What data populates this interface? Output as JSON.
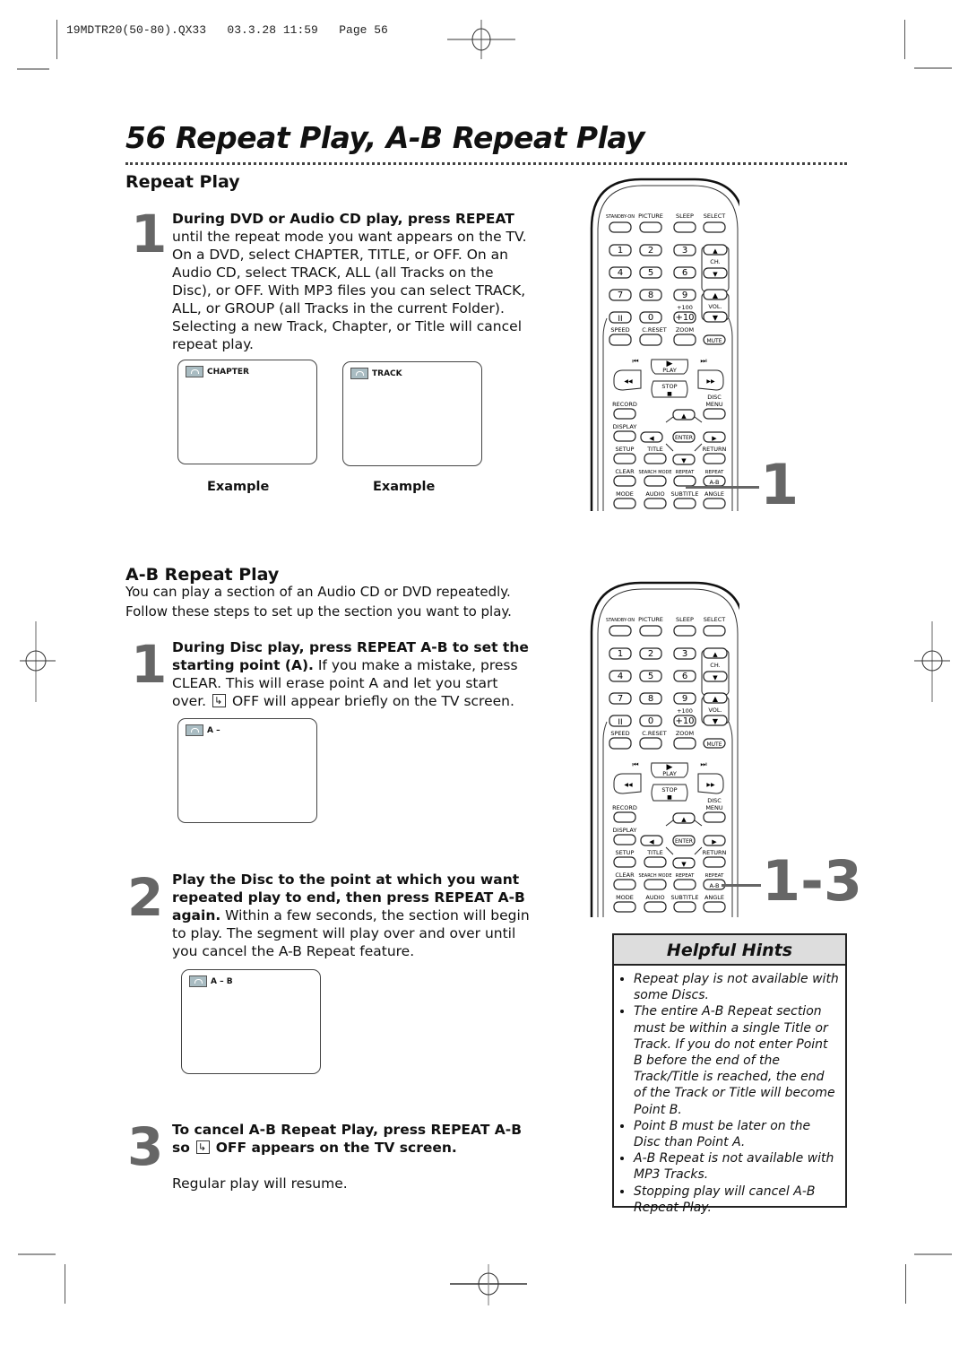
{
  "slug": "19MDTR20(50-80).QX33   03.3.28 11:59   Page 56",
  "page_title": "56  Repeat Play, A-B Repeat Play",
  "repeat_play": {
    "heading": "Repeat Play",
    "step1": {
      "number": "1",
      "bold": "During DVD or Audio CD play, press REPEAT",
      "text": "until the repeat mode you want appears on the TV. On a DVD, select CHAPTER, TITLE, or OFF.  On an Audio CD, select TRACK, ALL (all Tracks on the Disc), or OFF.  With MP3 files you can select TRACK, ALL, or GROUP (all Tracks in the current Folder).  Selecting a new Track, Chapter, or Title will cancel repeat play."
    },
    "screens": [
      {
        "label": "CHAPTER",
        "caption": "Example"
      },
      {
        "label": "TRACK",
        "caption": "Example"
      }
    ]
  },
  "ab_repeat": {
    "heading": "A-B Repeat Play",
    "intro": "You can play a section of an Audio CD or DVD repeatedly. Follow these steps to set up the section you want to play.",
    "step1": {
      "number": "1",
      "bold": "During Disc play, press REPEAT A-B to set the starting point (A).",
      "text1": " If you make a mistake, press CLEAR.  This will erase point A and let you start over.",
      "text2": "OFF will appear briefly on the TV screen.",
      "screen_label": "A –"
    },
    "step2": {
      "number": "2",
      "bold": "Play the Disc to the point at which you want repeated play to end, then press REPEAT A-B again.",
      "text": " Within a few seconds, the section will begin to play. The segment will play over and over until you cancel the A-B Repeat feature.",
      "screen_label": "A – B"
    },
    "step3": {
      "number": "3",
      "bold1": "To cancel A-B Repeat Play, press REPEAT A-B so",
      "bold2": "OFF appears on the TV screen.",
      "text": "Regular play will resume."
    }
  },
  "remote": {
    "top_labels": [
      "STANDBY-ON",
      "PICTURE",
      "SLEEP",
      "SELECT"
    ],
    "digits": [
      "1",
      "2",
      "3",
      "4",
      "5",
      "6",
      "7",
      "8",
      "9",
      "0",
      "+10"
    ],
    "plus100": "+100",
    "ch_label": "CH.",
    "vol_label": "VOL.",
    "speed": "SPEED",
    "creset": "C.RESET",
    "zoom": "ZOOM",
    "mute": "MUTE",
    "play": "PLAY",
    "stop": "STOP",
    "record": "RECORD",
    "disc_menu1": "DISC",
    "disc_menu2": "MENU",
    "display": "DISPLAY",
    "enter": "ENTER",
    "setup": "SETUP",
    "title": "TITLE",
    "return": "RETURN",
    "clear": "CLEAR",
    "search_mode": "SEARCH MODE",
    "repeat": "REPEAT",
    "repeat_ab": "REPEAT",
    "ab": "A-B",
    "mode": "MODE",
    "audio": "AUDIO",
    "subtitle": "SUBTITLE",
    "angle": "ANGLE"
  },
  "callouts": {
    "top": "1",
    "bottom": "1-3"
  },
  "hints": {
    "title": "Helpful Hints",
    "items": [
      "Repeat play is not available with some Discs.",
      "The entire A-B Repeat section must be within a single Title or Track. If you do not enter Point B before the end of the Track/Title is reached, the end of the Track or Title will become Point B.",
      "Point B must be later on the Disc than Point A.",
      "A-B Repeat is not available with MP3 Tracks.",
      "Stopping play will cancel A-B Repeat Play."
    ]
  }
}
